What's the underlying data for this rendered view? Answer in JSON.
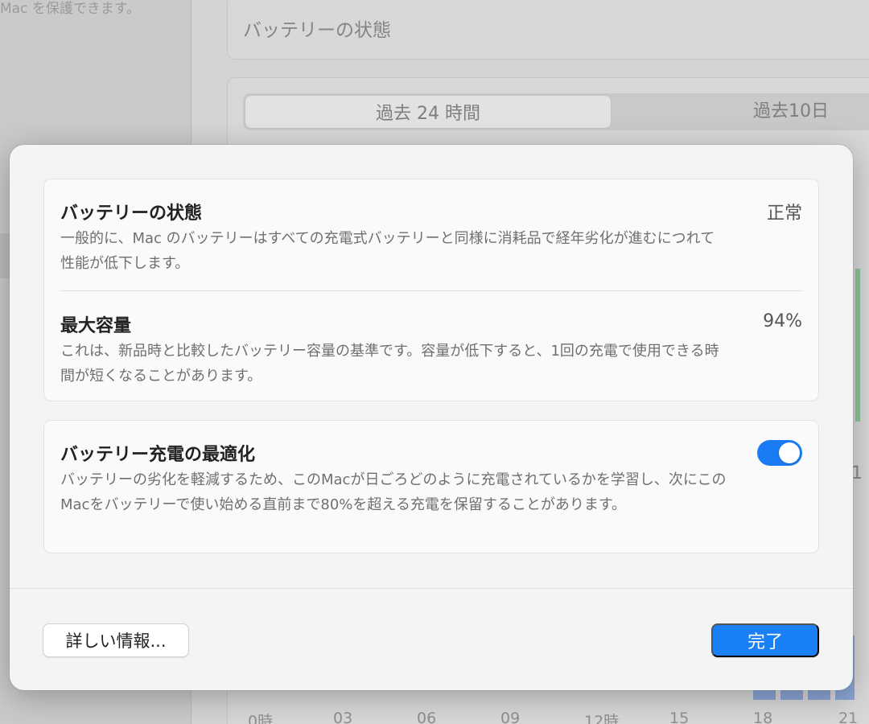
{
  "background": {
    "sidebar_caption": "Mac を保護できます。",
    "header_title": "バッテリーの状態",
    "segments": [
      "過去 24 時間",
      "過去10日"
    ],
    "side_number": "1",
    "x_ticks": [
      "0時",
      "03",
      "06",
      "09",
      "12時",
      "15",
      "18",
      "21"
    ]
  },
  "sheet": {
    "battery_health": {
      "title": "バッテリーの状態",
      "value": "正常",
      "description": "一般的に、Mac のバッテリーはすべての充電式バッテリーと同様に消耗品で経年劣化が進むにつれて性能が低下します。"
    },
    "max_capacity": {
      "title": "最大容量",
      "value": "94%",
      "description": "これは、新品時と比較したバッテリー容量の基準です。容量が低下すると、1回の充電で使用できる時間が短くなることがあります。"
    },
    "optimized_charging": {
      "title": "バッテリー充電の最適化",
      "enabled": true,
      "description": "バッテリーの劣化を軽減するため、このMacが日ごろどのように充電されているかを学習し、次にこのMacをバッテリーで使い始める直前まで80%を超える充電を保留することがあります。"
    },
    "buttons": {
      "more_info": "詳しい情報...",
      "done": "完了"
    }
  },
  "colors": {
    "accent": "#1a80f6",
    "toggle_on": "#1a7cf5"
  }
}
